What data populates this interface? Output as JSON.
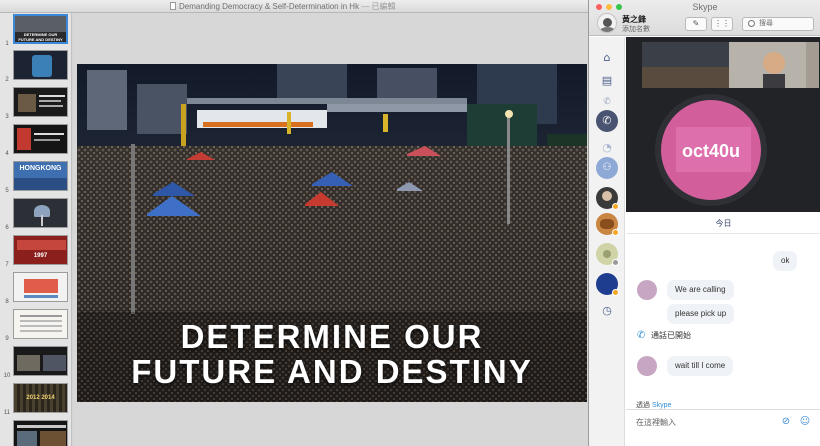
{
  "keynote": {
    "window_title": "Demanding Democracy & Self-Determination in Hk",
    "title_suffix": "— 已編輯",
    "slide_numbers": [
      "1",
      "2",
      "3",
      "4",
      "5",
      "6",
      "7",
      "8",
      "9",
      "10",
      "11",
      "12"
    ],
    "thumb_labels": {
      "t1": "DETERMINE OUR FUTURE AND DESTINY",
      "t5": "HONGKONG",
      "t7": "1997",
      "t11": "2012 2014"
    },
    "slide": {
      "headline_line1": "DETERMINE OUR",
      "headline_line2": "FUTURE AND DESTINY"
    }
  },
  "skype": {
    "app_title": "Skype",
    "profile_name": "黃之鋒",
    "profile_status": "添加名數",
    "search_placeholder": "搜尋",
    "today_label": "今日",
    "messages": {
      "ok": "ok",
      "m1": "We are calling",
      "m2": "please pick up",
      "call_started": "通話已開始",
      "m3": "wait till I come"
    },
    "via_label": "透過",
    "via_service": "Skype",
    "composer_placeholder": "在這裡輸入"
  },
  "colors": {
    "accent": "#3d87d9",
    "rail_icon": "#4b5f8a",
    "bubble": "#eff2f6",
    "skype_blue": "#2e8fd6"
  },
  "icons": {
    "home": "home-icon",
    "contacts": "contacts-icon",
    "recent_calls": "phone-icon",
    "current_call": "active-call-icon",
    "history": "clock-icon"
  }
}
